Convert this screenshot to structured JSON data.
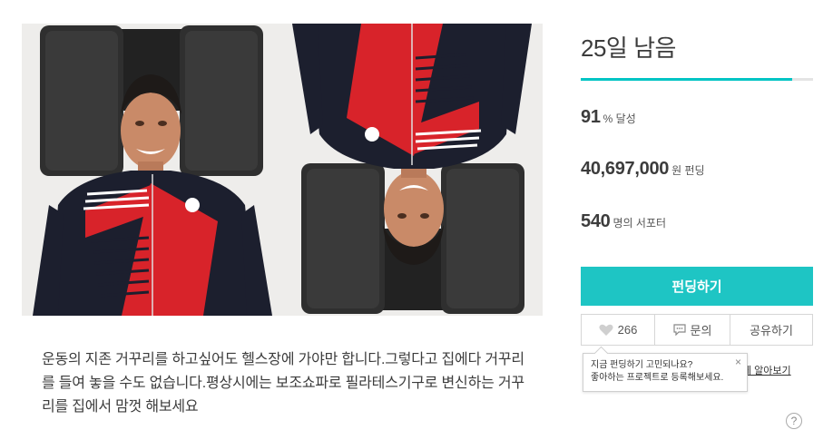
{
  "project": {
    "description": "운동의 지존 거꾸리를 하고싶어도 헬스장에 가야만 합니다.그렇다고 집에다 거꾸리를 들여 놓을 수도 없습니다.평상시에는 보조쇼파로 필라테스기구로 변신하는 거꾸리를 집에서 맘껏 해보세요"
  },
  "status": {
    "days_left": "25일 남음",
    "progress_fraction": 0.91,
    "rate_value": "91",
    "rate_unit": "% 달성",
    "amount_value": "40,697,000",
    "amount_unit": "원 펀딩",
    "backers_value": "540",
    "backers_unit": "명의 서포터"
  },
  "actions": {
    "fund_label": "펀딩하기",
    "like_count": "266",
    "ask_label": "문의",
    "share_label": "공유하기",
    "notify_label": "에 알아보기"
  },
  "tooltip": {
    "line1": "지금 펀딩하기 고민되나요?",
    "line2": "좋아하는 프로젝트로 등록해보세요.",
    "close": "×"
  },
  "help": {
    "label": "?"
  },
  "colors": {
    "accent": "#1ec5c4",
    "progress": "#00c4c4",
    "jacket_red": "#d8232a",
    "jacket_navy": "#1c1f2e",
    "cushion": "#2b2b2b"
  },
  "icons": [
    "heart-icon",
    "chat-icon",
    "close-icon",
    "help-icon"
  ]
}
